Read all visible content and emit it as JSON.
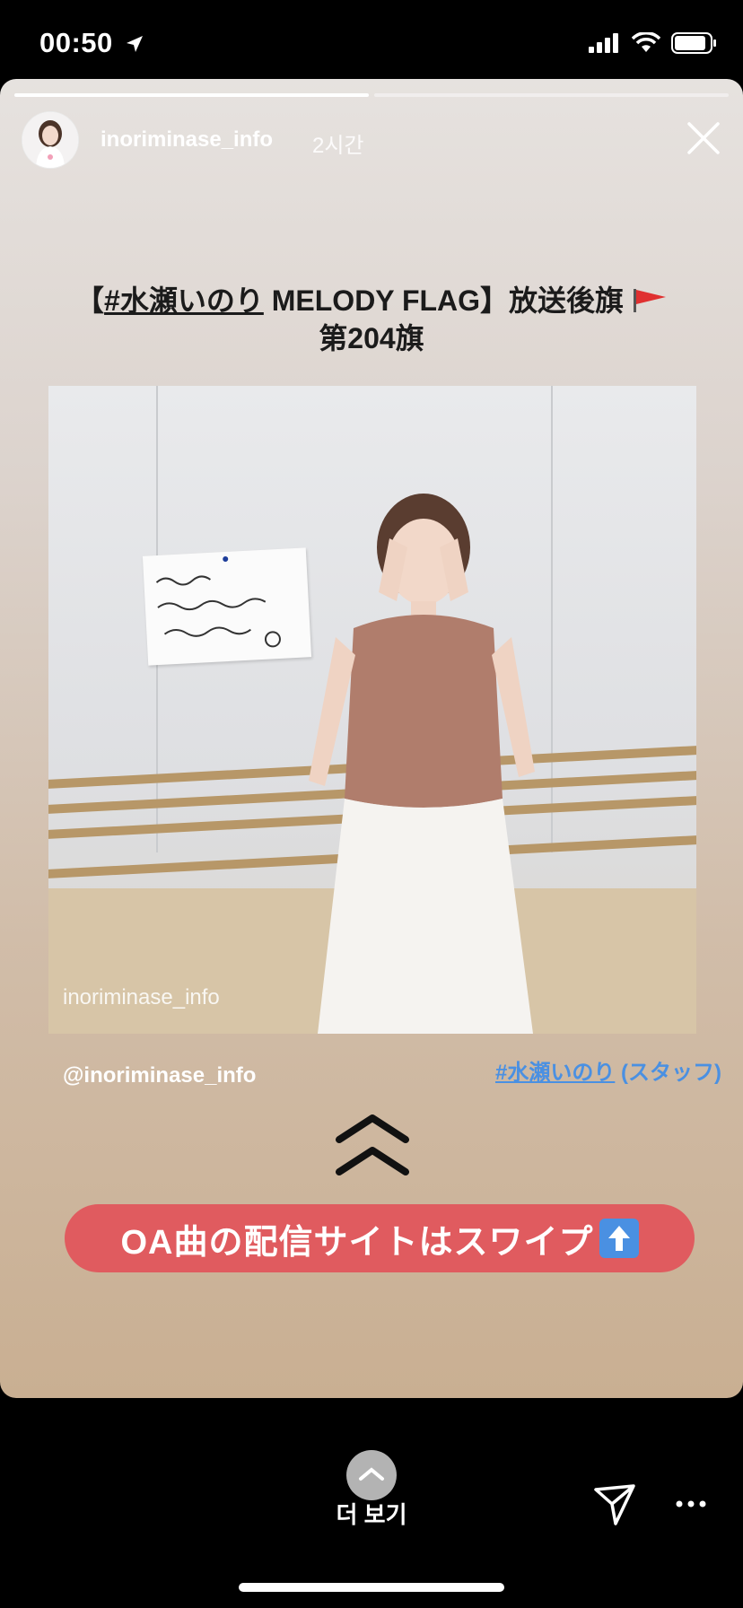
{
  "status_bar": {
    "time": "00:50"
  },
  "story": {
    "progress": {
      "segments": 2,
      "current": 1,
      "fraction_of_current": 1.0
    },
    "username": "inoriminase_info",
    "time_ago": "2시간",
    "title_line1_prefix": "【",
    "title_hashtag": "#水瀬いのり",
    "title_line1_suffix": " MELODY FLAG】放送後旗",
    "title_line2": "第204旗",
    "photo_watermark": "inoriminase_info",
    "mention": "@inoriminase_info",
    "tag_link_main": "#水瀬いのり",
    "tag_link_suffix": " (スタッフ)",
    "cta_text": "OA曲の配信サイトはスワイプ"
  },
  "bottom_bar": {
    "more_label": "더 보기"
  },
  "colors": {
    "cta": "#e05b5f",
    "link": "#4a90e2"
  }
}
